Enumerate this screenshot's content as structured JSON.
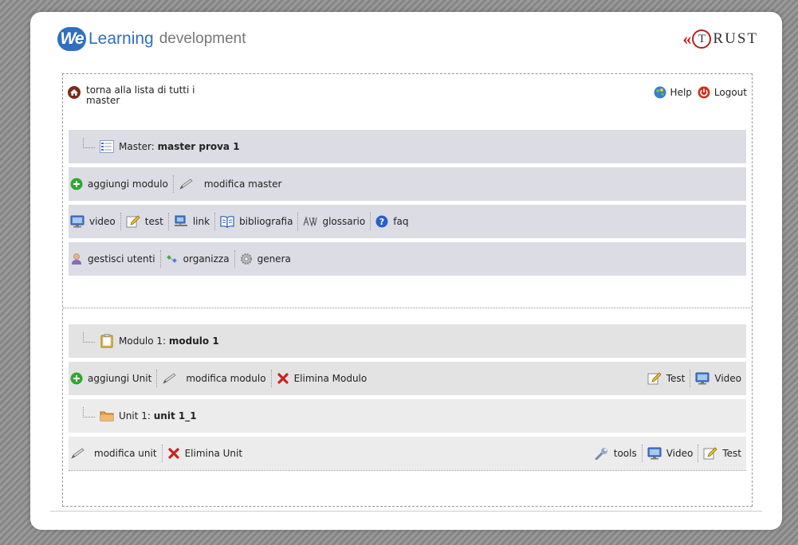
{
  "header": {
    "logo_we": "We",
    "logo_learning": "Learning",
    "logo_dev": "development",
    "trust_t": "T",
    "trust_rest": "RUST"
  },
  "top": {
    "home_link": "torna alla lista di tutti i master",
    "help": "Help",
    "logout": "Logout"
  },
  "master": {
    "prefix": "Master:",
    "name": "master prova 1",
    "actions": [
      "aggiungi modulo",
      "modifica master"
    ],
    "tools": [
      "video",
      "test",
      "link",
      "bibliografia",
      "glossario",
      "faq"
    ],
    "manage": [
      "gestisci utenti",
      "organizza",
      "genera"
    ]
  },
  "module": {
    "prefix": "Modulo 1:",
    "name": "modulo 1",
    "actions": [
      "aggiungi Unit",
      "modifica modulo",
      "Elimina Modulo"
    ],
    "right_actions": [
      "Test",
      "Video"
    ]
  },
  "unit": {
    "prefix": "Unit 1:",
    "name": "unit 1_1",
    "actions": [
      "modifica unit",
      "Elimina Unit"
    ],
    "right_actions": [
      "tools",
      "Video",
      "Test"
    ]
  },
  "colors": {
    "accent_blue": "#2f6fbf",
    "trust_red": "#b22222",
    "row_bg": "#dcdce4"
  }
}
